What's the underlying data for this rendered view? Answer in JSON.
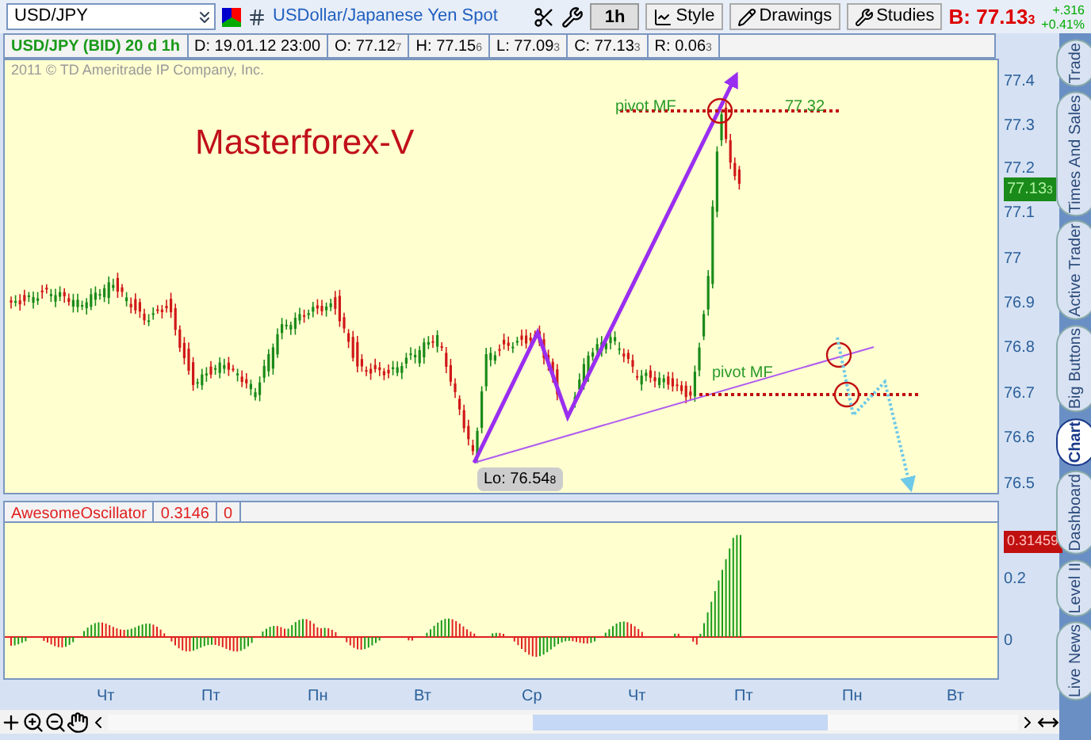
{
  "toolbar": {
    "symbol": "USD/JPY",
    "description": "USDollar/Japanese Yen Spot",
    "interval": "1h",
    "buttons": [
      "Style",
      "Drawings",
      "Studies"
    ],
    "bid": {
      "label": "B:",
      "price": "77.13",
      "small": "3"
    },
    "change": "+.316",
    "change_pct": "+0.41%"
  },
  "info": {
    "title": "USD/JPY (BID) 20 d 1h",
    "fields": [
      {
        "text": "D: 19.01.12 23:00"
      },
      {
        "text": "O: 77.12",
        "small": "7"
      },
      {
        "text": "H: 77.15",
        "small": "6"
      },
      {
        "text": "L: 77.09",
        "small": "3"
      },
      {
        "text": "C: 77.13",
        "small": "3"
      },
      {
        "text": "R: 0.06",
        "small": "3"
      }
    ]
  },
  "copyright": "2011 © TD Ameritrade IP Company, Inc.",
  "chart_label": "Masterforex-V",
  "annotations": [
    {
      "text": "pivot MF"
    },
    {
      "text": "77.32"
    },
    {
      "text": "pivot MF"
    }
  ],
  "low_label": {
    "text": "Lo: 76.54",
    "small": "8"
  },
  "price_axis": [
    "77.4",
    "77.3",
    "77.2",
    "77.1",
    "77",
    "76.9",
    "76.8",
    "76.7",
    "76.6",
    "76.5"
  ],
  "last_price": {
    "text": "77.13",
    "small": "3"
  },
  "oscillator": {
    "name": "AwesomeOscillator",
    "value": "0.3146",
    "param": "0",
    "badge": "0.31459",
    "axis": [
      "0.2",
      "0"
    ]
  },
  "x_axis": [
    "Чт",
    "Пт",
    "Пн",
    "Вт",
    "Ср",
    "Чт",
    "Пт",
    "Пн",
    "Вт"
  ],
  "side_tabs": [
    {
      "label": "Trade",
      "selected": false
    },
    {
      "label": "Times And Sales",
      "selected": false
    },
    {
      "label": "Active Trader",
      "selected": false
    },
    {
      "label": "Big Buttons",
      "selected": false
    },
    {
      "label": "Chart",
      "selected": true
    },
    {
      "label": "Dashboard",
      "selected": false
    },
    {
      "label": "Level II",
      "selected": false
    },
    {
      "label": "Live News",
      "selected": false
    }
  ]
}
